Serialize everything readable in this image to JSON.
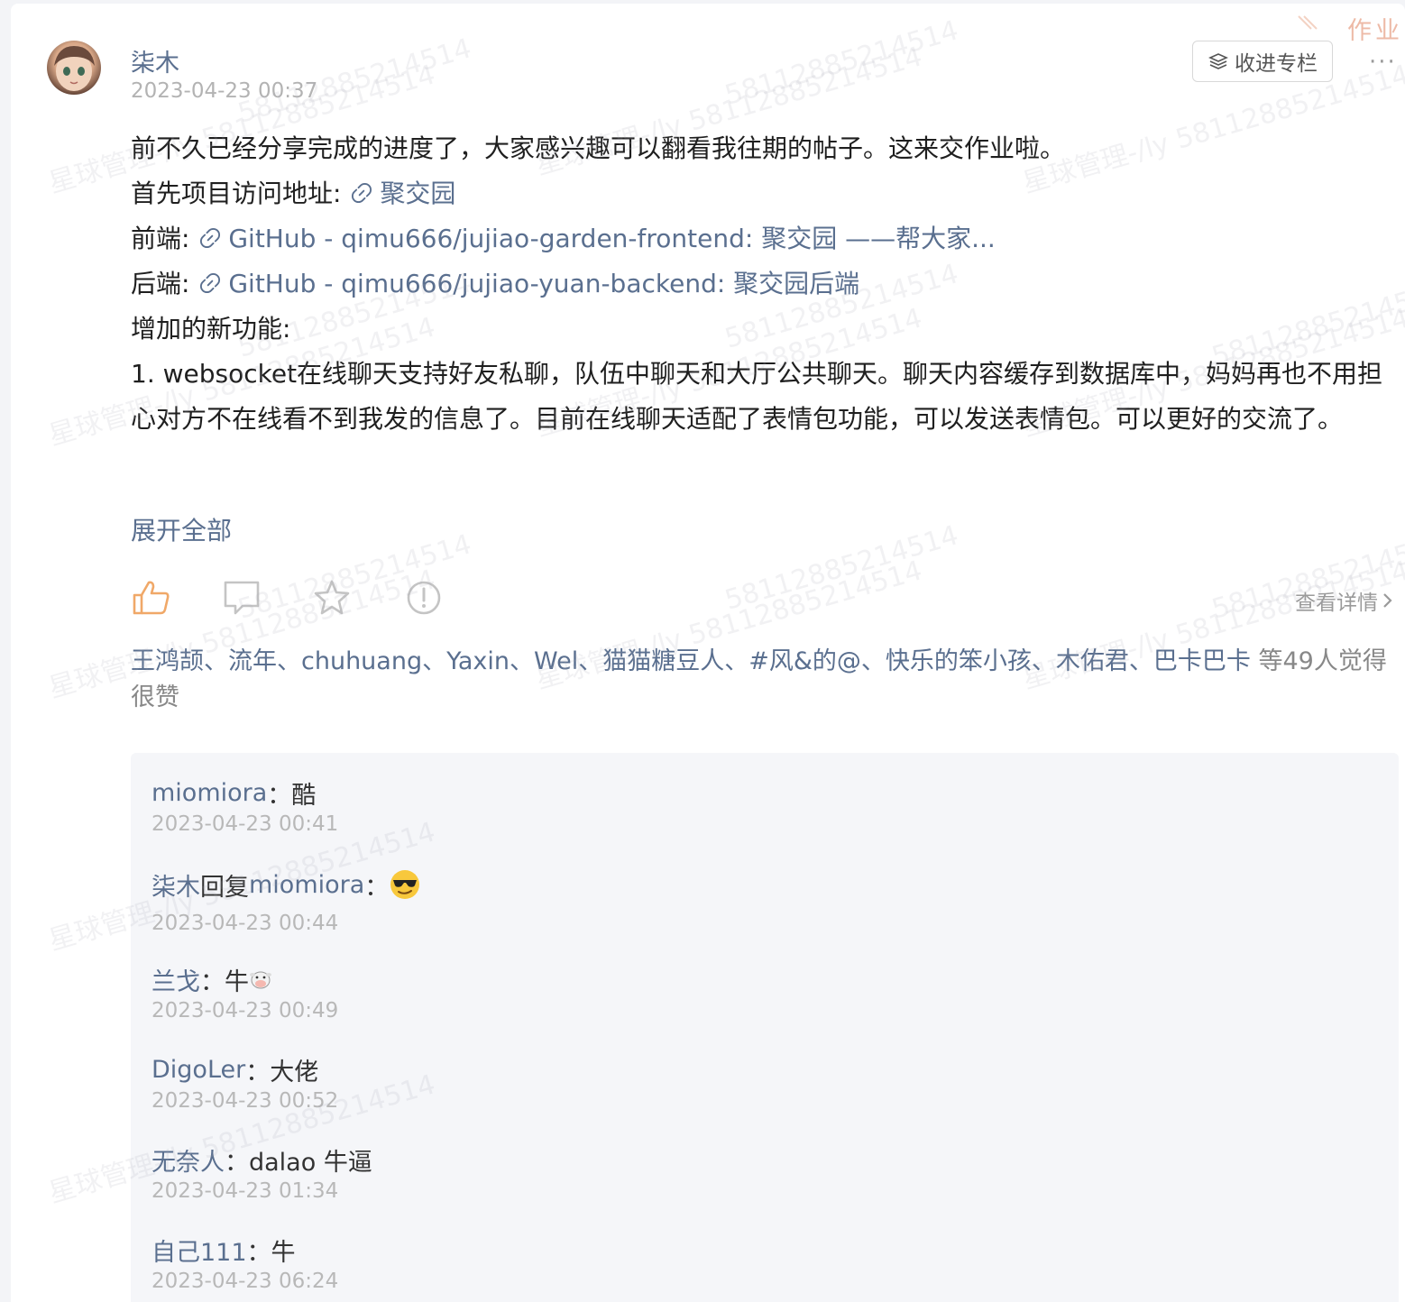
{
  "post": {
    "author": "柒木",
    "time": "2023-04-23 00:37",
    "collect_label": "收进专栏",
    "more_label": "···",
    "tag": "作业",
    "paragraphs": {
      "intro": "前不久已经分享完成的进度了，大家感兴趣可以翻看我往期的帖子。这来交作业啦。",
      "site_prefix": "首先项目访问地址: ",
      "site_link": "聚交园",
      "frontend_prefix": "前端: ",
      "frontend_link": "GitHub - qimu666/jujiao-garden-frontend: 聚交园 ——帮大家...",
      "backend_prefix": "后端: ",
      "backend_link": "GitHub - qimu666/jujiao-yuan-backend: 聚交园后端",
      "features_heading": "增加的新功能:",
      "feature_1": " 1. websocket在线聊天支持好友私聊，队伍中聊天和大厅公共聊天。聊天内容缓存到数据库中，妈妈再也不用担心对方不在线看不到我发的信息了。目前在线聊天适配了表情包功能，可以发送表情包。可以更好的交流了。"
    },
    "expand_label": "展开全部",
    "detail_label": "查看详情",
    "likes": {
      "names": "王鸿颉、流年、chuhuang、Yaxin、Wel、猫猫糖豆人、#风&的@、快乐的笨小孩、木佑君、巴卡巴卡",
      "suffix": " 等49人觉得很赞"
    }
  },
  "comments": [
    {
      "user": "miomiora",
      "sep": "：",
      "text": "酷",
      "time": "2023-04-23 00:41"
    },
    {
      "user": "柒木",
      "reply": " 回复 ",
      "reply_to": "miomiora",
      "sep": "：",
      "emoji": "sunglasses-emoji",
      "time": "2023-04-23 00:44"
    },
    {
      "user": "兰戈",
      "sep": "：",
      "text": "牛",
      "emoji": "cow-face-emoji",
      "time": "2023-04-23 00:49"
    },
    {
      "user": "DigoLer",
      "sep": "：",
      "text": "大佬",
      "time": "2023-04-23 00:52"
    },
    {
      "user": "无奈人",
      "sep": "：",
      "text": "dalao 牛逼",
      "time": "2023-04-23 01:34"
    },
    {
      "user": "自己111",
      "sep": "：",
      "text": "牛",
      "time": "2023-04-23 06:24"
    }
  ],
  "watermark": {
    "text_a": "星球管理-/ly 58112885214514",
    "text_b": "58112885214514"
  },
  "colors": {
    "link": "#5a6f8f",
    "like_active": "#f0a868",
    "muted": "#b3b3b3"
  }
}
